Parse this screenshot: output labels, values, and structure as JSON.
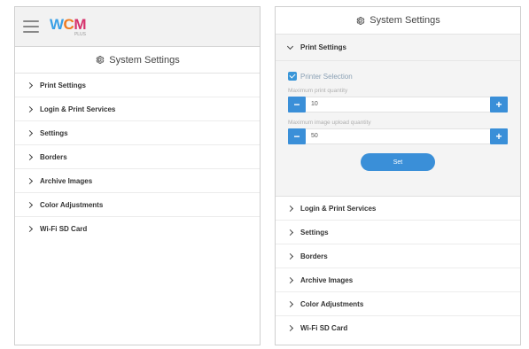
{
  "left_panel": {
    "logo": {
      "main_c1": "W",
      "main_c2": "C",
      "main_c3": "M",
      "sub": "PLUS"
    },
    "title": "System Settings",
    "menu": [
      {
        "label": "Print Settings"
      },
      {
        "label": "Login & Print Services"
      },
      {
        "label": "Settings"
      },
      {
        "label": "Borders"
      },
      {
        "label": "Archive Images"
      },
      {
        "label": "Color Adjustments"
      },
      {
        "label": "Wi-Fi SD Card"
      }
    ]
  },
  "right_panel": {
    "title": "System Settings",
    "expanded_section": {
      "label": "Print Settings",
      "printer_selection_label": "Printer Selection",
      "printer_selection_checked": true,
      "max_print_label": "Maximum print quantity",
      "max_print_value": "10",
      "max_upload_label": "Maximum image upload quantity",
      "max_upload_value": "50",
      "set_label": "Set"
    },
    "menu": [
      {
        "label": "Login & Print Services"
      },
      {
        "label": "Settings"
      },
      {
        "label": "Borders"
      },
      {
        "label": "Archive Images"
      },
      {
        "label": "Color Adjustments"
      },
      {
        "label": "Wi-Fi SD Card"
      }
    ]
  },
  "icons": {
    "minus": "−",
    "plus": "+"
  },
  "colors": {
    "accent": "#3a8fd8",
    "logo_blue": "#3aa0e6",
    "logo_orange": "#f07a1e",
    "logo_pink": "#d6326c"
  }
}
